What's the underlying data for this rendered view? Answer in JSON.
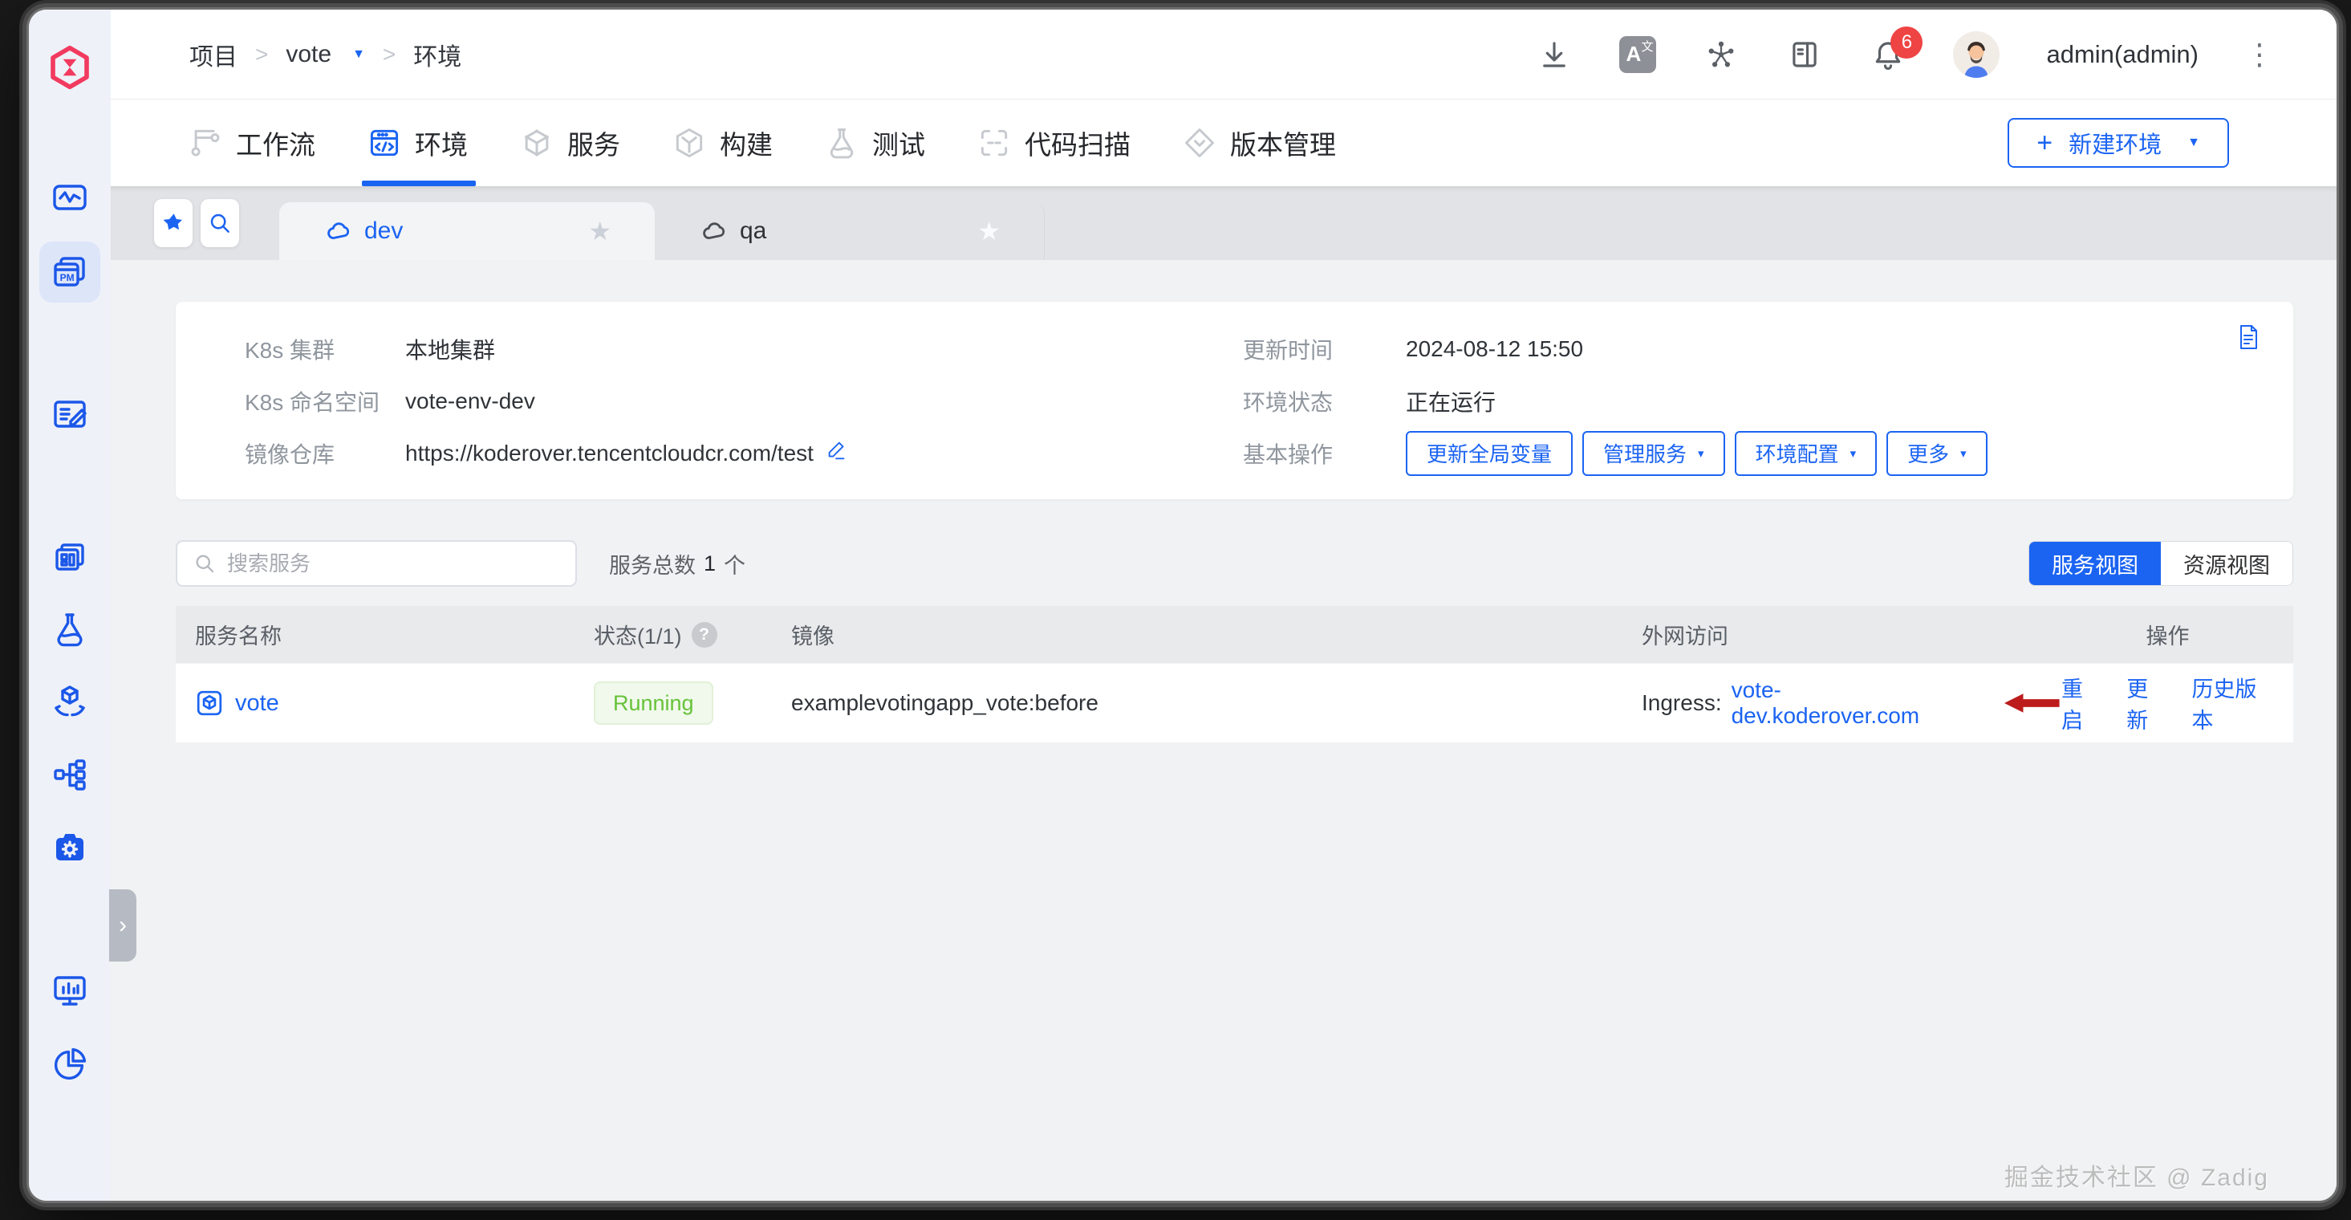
{
  "colors": {
    "accent": "#1b64f2",
    "logo_pink": "#f23a5f",
    "running_green": "#67c23a",
    "running_bg": "#f0f9eb",
    "badge_red": "#ef4444",
    "arrow_red": "#bd1c1c"
  },
  "header": {
    "breadcrumb": {
      "root": "项目",
      "project": "vote",
      "current": "环境"
    },
    "username": "admin(admin)",
    "notification_count": "6",
    "icons": [
      "download-icon",
      "translate-icon",
      "hub-icon",
      "docs-book-icon",
      "bell-icon",
      "avatar",
      "more-kebab-icon"
    ]
  },
  "nav": {
    "tabs": [
      {
        "label": "工作流"
      },
      {
        "label": "环境",
        "active": true
      },
      {
        "label": "服务"
      },
      {
        "label": "构建"
      },
      {
        "label": "测试"
      },
      {
        "label": "代码扫描"
      },
      {
        "label": "版本管理"
      }
    ],
    "new_env_button": "新建环境"
  },
  "env_tabs": {
    "tabs": [
      {
        "name": "dev",
        "active": true
      },
      {
        "name": "qa",
        "active": false
      }
    ]
  },
  "env_info": {
    "fields_left": [
      {
        "label": "K8s 集群",
        "value": "本地集群"
      },
      {
        "label": "K8s 命名空间",
        "value": "vote-env-dev"
      },
      {
        "label": "镜像仓库",
        "value": "https://koderover.tencentcloudcr.com/test"
      }
    ],
    "fields_right": [
      {
        "label": "更新时间",
        "value": "2024-08-12 15:50"
      },
      {
        "label": "环境状态",
        "value": "正在运行"
      }
    ],
    "ops_label": "基本操作",
    "ops_buttons": [
      {
        "label": "更新全局变量",
        "dropdown": false
      },
      {
        "label": "管理服务",
        "dropdown": true
      },
      {
        "label": "环境配置",
        "dropdown": true
      },
      {
        "label": "更多",
        "dropdown": true
      }
    ]
  },
  "services": {
    "search_placeholder": "搜索服务",
    "total_label": "服务总数",
    "total_count": "1",
    "total_unit": "个",
    "view_toggle": [
      {
        "label": "服务视图",
        "active": true
      },
      {
        "label": "资源视图",
        "active": false
      }
    ],
    "table": {
      "headers": [
        "服务名称",
        "状态(1/1)",
        "镜像",
        "外网访问",
        "操作"
      ],
      "rows": [
        {
          "name": "vote",
          "status": "Running",
          "image": "examplevotingapp_vote:before",
          "ingress_label": "Ingress:",
          "ingress_url": "vote-dev.koderover.com",
          "actions": [
            "重启",
            "更新",
            "历史版本"
          ]
        }
      ]
    }
  },
  "sidebar": {
    "icons": [
      "dashboard-monitor-icon",
      "projects-pm-icon",
      "release-note-icon",
      "template-library-icon",
      "quality-flask-icon",
      "delivery-box-icon",
      "resource-tree-icon",
      "system-settings-icon",
      "data-statistics-icon",
      "insight-pie-icon"
    ]
  },
  "icon_glyphs": {
    "pm": "PM",
    "translate_a": "A",
    "translate_wen": "文",
    "help": "?"
  },
  "annotations": {
    "row_arrow": "red-left-arrow"
  },
  "watermark": "掘金技术社区 @ Zadig"
}
